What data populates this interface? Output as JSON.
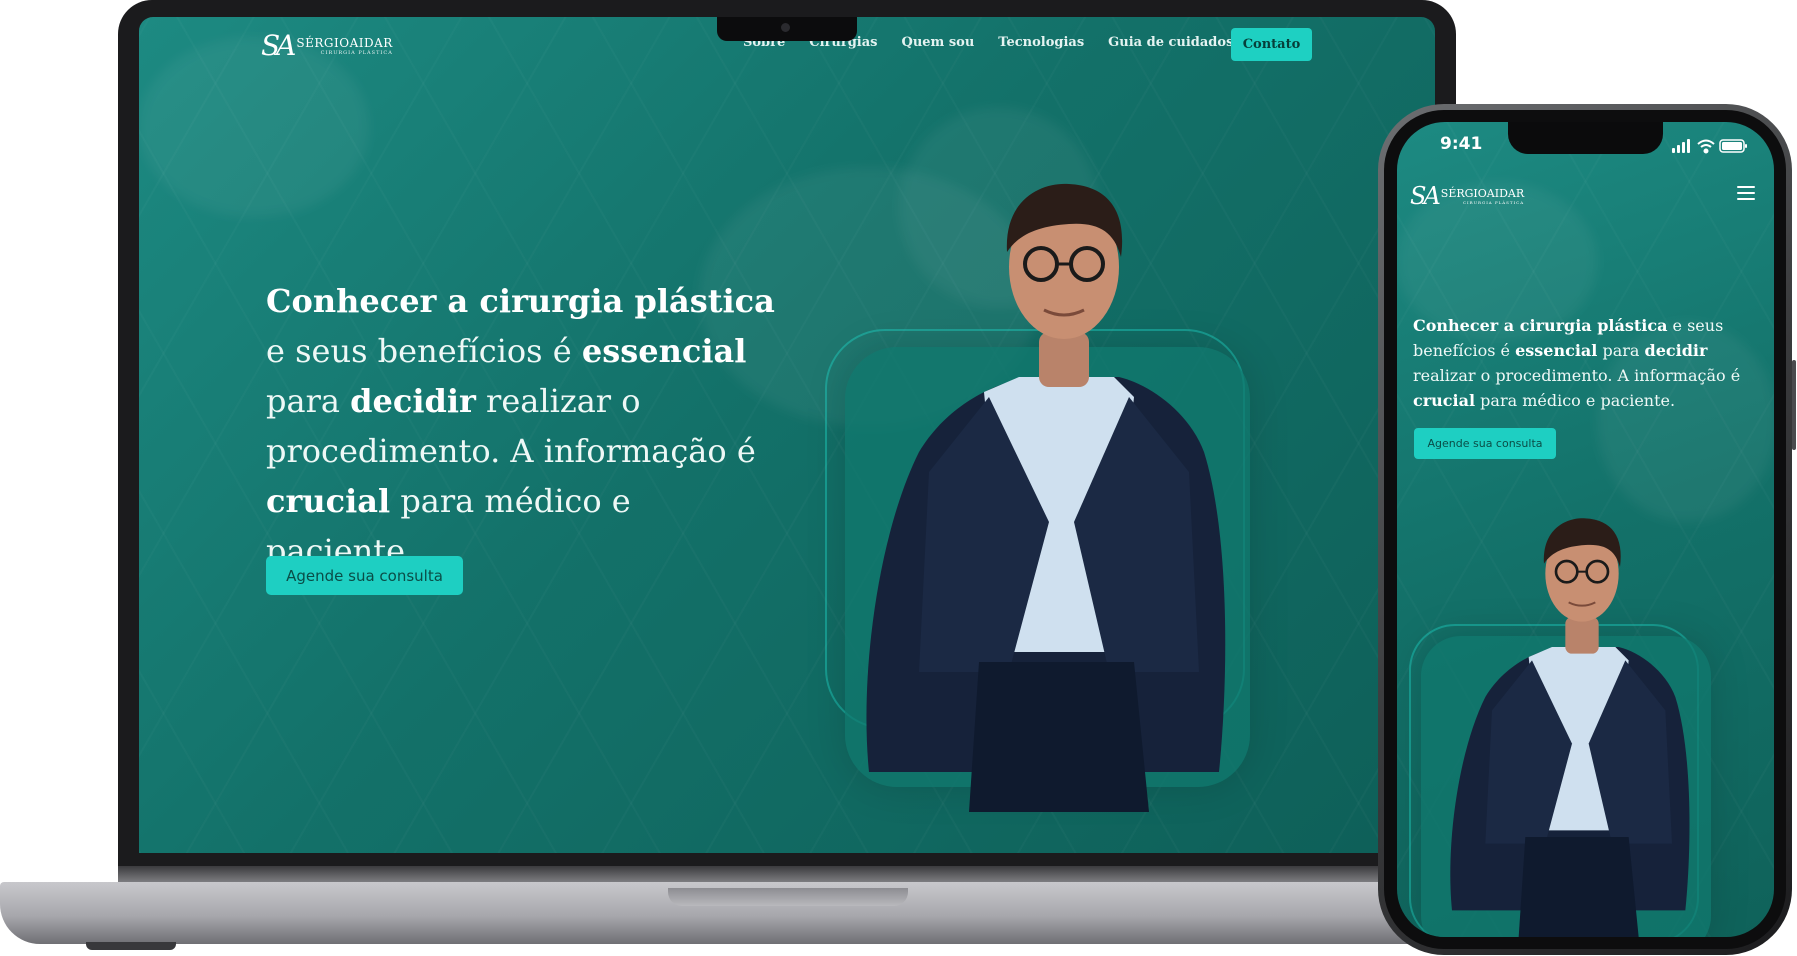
{
  "site": {
    "logo_monogram": "SA",
    "logo_name": "SÉRGIOAIDAR",
    "logo_subtitle": "CIRURGIA PLÁSTICA"
  },
  "laptop": {
    "nav": [
      "Sobre",
      "Cirurgias",
      "Quem sou",
      "Tecnologias",
      "Guia de cuidados"
    ],
    "contact_label": "Contato",
    "headline": [
      {
        "text": "Conhecer a cirurgia plástica",
        "bold": true
      },
      {
        "text": " e seus benefícios é ",
        "bold": false
      },
      {
        "text": "essencial",
        "bold": true
      },
      {
        "text": " para ",
        "bold": false
      },
      {
        "text": "decidir",
        "bold": true
      },
      {
        "text": " realizar o procedimento. A informação é ",
        "bold": false
      },
      {
        "text": "crucial",
        "bold": true
      },
      {
        "text": " para médico e paciente.",
        "bold": false
      }
    ],
    "cta_label": "Agende sua consulta"
  },
  "phone": {
    "time": "9:41",
    "headline": [
      {
        "text": "Conhecer a cirurgia plástica",
        "bold": true
      },
      {
        "text": " e seus benefícios é ",
        "bold": false
      },
      {
        "text": "essencial",
        "bold": true
      },
      {
        "text": " para ",
        "bold": false
      },
      {
        "text": "decidir",
        "bold": true
      },
      {
        "text": " realizar o procedimento. A informação é ",
        "bold": false
      },
      {
        "text": "crucial",
        "bold": true
      },
      {
        "text": " para médico e paciente.",
        "bold": false
      }
    ],
    "cta_label": "Agende sua consulta"
  },
  "colors": {
    "background_teal": "#137169",
    "accent_cyan": "#1ed0c2",
    "jacket_navy": "#16223a",
    "shirt_light_blue": "#cfe0ef"
  },
  "icons": [
    "hamburger-menu-icon",
    "signal-icon",
    "wifi-icon",
    "battery-icon",
    "camera-icon"
  ]
}
